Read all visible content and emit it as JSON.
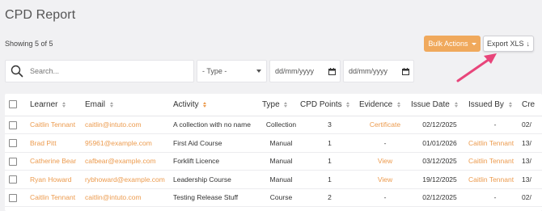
{
  "page": {
    "title": "CPD Report",
    "showing_text": "Showing 5 of 5"
  },
  "toolbar": {
    "bulk_actions_label": "Bulk Actions",
    "export_label": "Export XLS",
    "export_icon": "↓"
  },
  "filters": {
    "search_placeholder": "Search...",
    "type_select_value": "- Type -",
    "date_from_placeholder": "dd/mm/yyyy",
    "date_to_placeholder": "dd/mm/yyyy"
  },
  "table": {
    "headers": {
      "learner": "Learner",
      "email": "Email",
      "activity": "Activity",
      "type": "Type",
      "cpd_points": "CPD Points",
      "evidence": "Evidence",
      "issue_date": "Issue Date",
      "issued_by": "Issued By",
      "created": "Cre"
    },
    "rows": [
      {
        "learner": "Caitlin Tennant",
        "email": "caitlin@intuto.com",
        "activity": "A collection with no name",
        "type": "Collection",
        "cpd_points": "3",
        "evidence": "Certificate",
        "issue_date": "02/12/2025",
        "issued_by": "-",
        "created": "02/"
      },
      {
        "learner": "Brad Pitt",
        "email": "95961@example.com",
        "activity": "First Aid Course",
        "type": "Manual",
        "cpd_points": "1",
        "evidence": "-",
        "issue_date": "01/01/2026",
        "issued_by": "Caitlin Tennant",
        "created": "13/"
      },
      {
        "learner": "Catherine Bear",
        "email": "cafbear@example.com",
        "activity": "Forklift Licence",
        "type": "Manual",
        "cpd_points": "1",
        "evidence": "View",
        "issue_date": "03/12/2025",
        "issued_by": "Caitlin Tennant",
        "created": "13/"
      },
      {
        "learner": "Ryan Howard",
        "email": "rybhoward@example.com",
        "activity": "Leadership Course",
        "type": "Manual",
        "cpd_points": "1",
        "evidence": "View",
        "issue_date": "19/12/2025",
        "issued_by": "Caitlin Tennant",
        "created": "13/"
      },
      {
        "learner": "Caitlin Tennant",
        "email": "caitlin@intuto.com",
        "activity": "Testing Release Stuff",
        "type": "Course",
        "cpd_points": "2",
        "evidence": "-",
        "issue_date": "02/12/2025",
        "issued_by": "-",
        "created": "02/"
      }
    ]
  },
  "colors": {
    "accent": "#ec9b4e",
    "bulk_button": "#f0a95c",
    "annotation_arrow": "#e8457a",
    "background": "#f1f1f3"
  },
  "icons": {
    "search": "search-icon",
    "calendar": "calendar-icon",
    "sort": "sort-icon",
    "caret": "chevron-down-icon",
    "annotation": "annotation-arrow"
  }
}
